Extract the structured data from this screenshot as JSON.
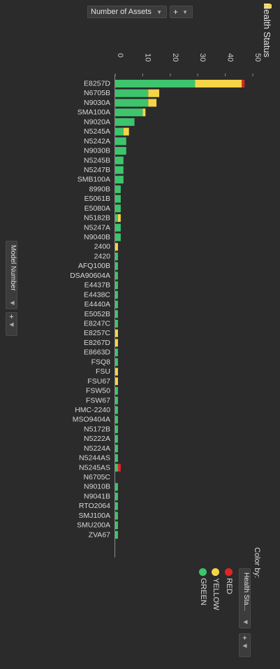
{
  "toolbar": {
    "measure_label": "Number of Assets",
    "add_label": "+"
  },
  "shelf": {
    "columns_title": "Health Status",
    "rows_label": "Model Number",
    "add_label": "+"
  },
  "color_panel": {
    "title": "Color by:",
    "field": "Health Sta...",
    "add_label": "+",
    "legend": [
      {
        "name": "RED",
        "color": "#e02424"
      },
      {
        "name": "YELLOW",
        "color": "#f5d547"
      },
      {
        "name": "GREEN",
        "color": "#3ec46d"
      }
    ]
  },
  "chart_data": {
    "type": "bar",
    "orientation": "horizontal",
    "stacked": true,
    "xlim": [
      0,
      50
    ],
    "ticks": [
      0,
      10,
      20,
      30,
      40,
      50
    ],
    "categories": [
      "E8257D",
      "N6705B",
      "N9030A",
      "SMA100A",
      "N9020A",
      "N5245A",
      "N5242A",
      "N9030B",
      "N5245B",
      "N5247B",
      "SMB100A",
      "8990B",
      "E5061B",
      "E5080A",
      "N5182B",
      "N5247A",
      "N9040B",
      "2400",
      "2420",
      "AFQ100B",
      "DSA90604A",
      "E4437B",
      "E4438C",
      "E4440A",
      "E5052B",
      "E8247C",
      "E8257C",
      "E8267D",
      "E8663D",
      "FSQ8",
      "FSU",
      "FSU67",
      "FSW50",
      "FSW67",
      "HMC-2240",
      "MSO9404A",
      "N5172B",
      "N5222A",
      "N5224A",
      "N5244AS",
      "N5245AS",
      "N6705C",
      "N9010B",
      "N9041B",
      "RTO2064",
      "SMJ100A",
      "SMU200A",
      "ZVA67"
    ],
    "series": [
      {
        "name": "GREEN",
        "color": "#3ec46d",
        "values": [
          29,
          12,
          12,
          10,
          7,
          3,
          4,
          4,
          3,
          3,
          3,
          2,
          2,
          2,
          1,
          2,
          2,
          0,
          1,
          1,
          1,
          1,
          1,
          1,
          1,
          1,
          0,
          0,
          1,
          1,
          0,
          0,
          1,
          1,
          1,
          1,
          1,
          1,
          1,
          1,
          1,
          0,
          1,
          1,
          1,
          1,
          1,
          1
        ]
      },
      {
        "name": "YELLOW",
        "color": "#f5d547",
        "values": [
          17,
          4,
          3,
          1,
          0,
          2,
          0,
          0,
          0,
          0,
          0,
          0,
          0,
          0,
          1,
          0,
          0,
          1,
          0,
          0,
          0,
          0,
          0,
          0,
          0,
          0,
          1,
          1,
          0,
          0,
          1,
          1,
          0,
          0,
          0,
          0,
          0,
          0,
          0,
          0,
          0,
          0,
          0,
          0,
          0,
          0,
          0,
          0
        ]
      },
      {
        "name": "RED",
        "color": "#e02424",
        "values": [
          1,
          0,
          0,
          0,
          0,
          0,
          0,
          0,
          0,
          0,
          0,
          0,
          0,
          0,
          0,
          0,
          0,
          0,
          0,
          0,
          0,
          0,
          0,
          0,
          0,
          0,
          0,
          0,
          0,
          0,
          0,
          0,
          0,
          0,
          0,
          0,
          0,
          0,
          0,
          0,
          1,
          0,
          0,
          0,
          0,
          0,
          0,
          0
        ]
      }
    ]
  }
}
